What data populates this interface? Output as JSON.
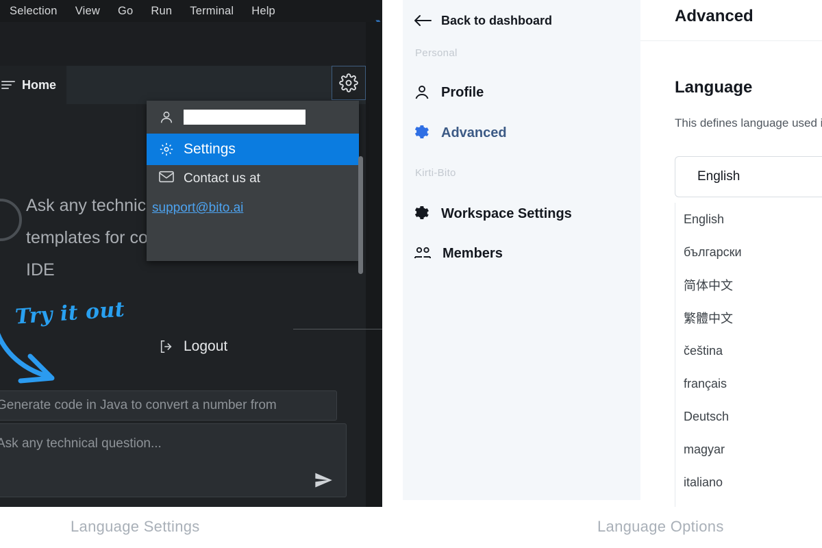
{
  "ide": {
    "menu_bar": [
      "Selection",
      "View",
      "Go",
      "Run",
      "Terminal",
      "Help"
    ],
    "panel_title": "Home",
    "promo_text": "Ask any technical question or use templates for common tasks right in your IDE",
    "annotation": "Try it out",
    "suggestion_text": "Generate code in Java to convert a number from",
    "composer_placeholder": "Ask any technical question...",
    "icons": {
      "hamburger": "hamburger-icon",
      "gear": "gear-icon",
      "send": "send-icon",
      "logo": "bito-logo-icon"
    }
  },
  "account_menu": {
    "username_value": "",
    "items": [
      {
        "label": "Settings",
        "icon": "gear-icon",
        "selected": true
      },
      {
        "label": "Contact us at",
        "icon": "mail-icon",
        "selected": false
      },
      {
        "label": "Logout",
        "icon": "logout-icon",
        "selected": false
      }
    ],
    "support_email": "support@bito.ai",
    "highlight_color": "#0b7ce0",
    "link_color": "#4da3f0",
    "background_color": "#3c4043"
  },
  "settings": {
    "back_label": "Back to dashboard",
    "sections": [
      {
        "label": "Personal"
      },
      {
        "label": "Kirti-Bito"
      }
    ],
    "nav": [
      {
        "label": "Profile",
        "icon": "person-icon",
        "active": false
      },
      {
        "label": "Advanced",
        "icon": "gear-icon",
        "active": true
      },
      {
        "label": "Workspace Settings",
        "icon": "gear-icon",
        "active": false
      },
      {
        "label": "Members",
        "icon": "people-icon",
        "active": false
      }
    ],
    "content": {
      "title": "Advanced",
      "language_heading": "Language",
      "language_description": "This defines language used in",
      "selected_language": "English",
      "options": [
        "English",
        "български",
        "简体中文",
        "繁體中文",
        "čeština",
        "français",
        "Deutsch",
        "magyar",
        "italiano"
      ]
    },
    "accent_color": "#2f6fe4"
  },
  "captions": {
    "left": "Language Settings",
    "right": "Language Options"
  }
}
